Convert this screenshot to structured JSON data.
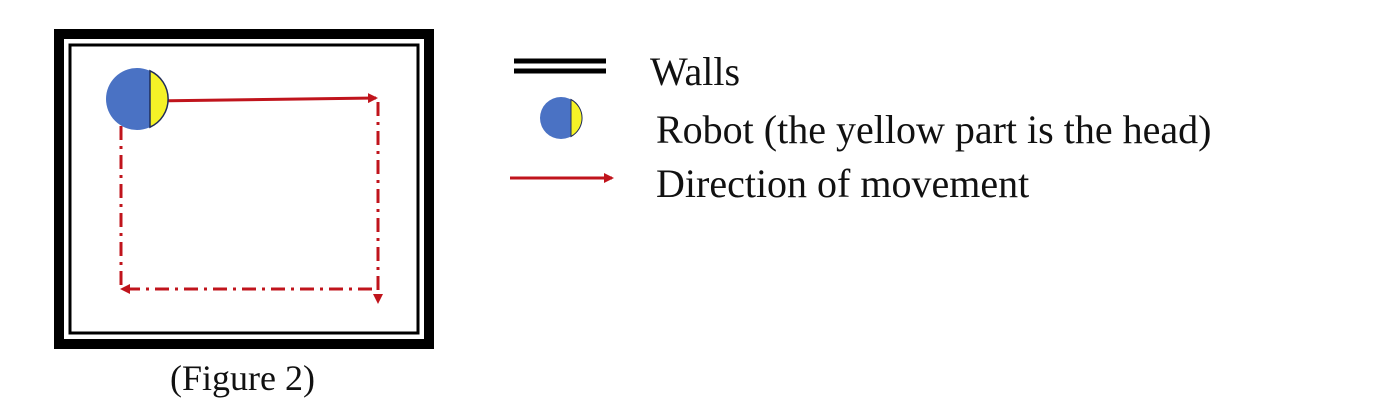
{
  "legend": {
    "walls_label": "Walls",
    "robot_label": "Robot (the yellow part is the head)",
    "direction_label": "Direction of movement"
  },
  "caption": "(Figure 2)",
  "colors": {
    "wall": "#000000",
    "robot_body": "#4a72c4",
    "robot_head": "#f5f227",
    "arrow": "#c0141c"
  }
}
